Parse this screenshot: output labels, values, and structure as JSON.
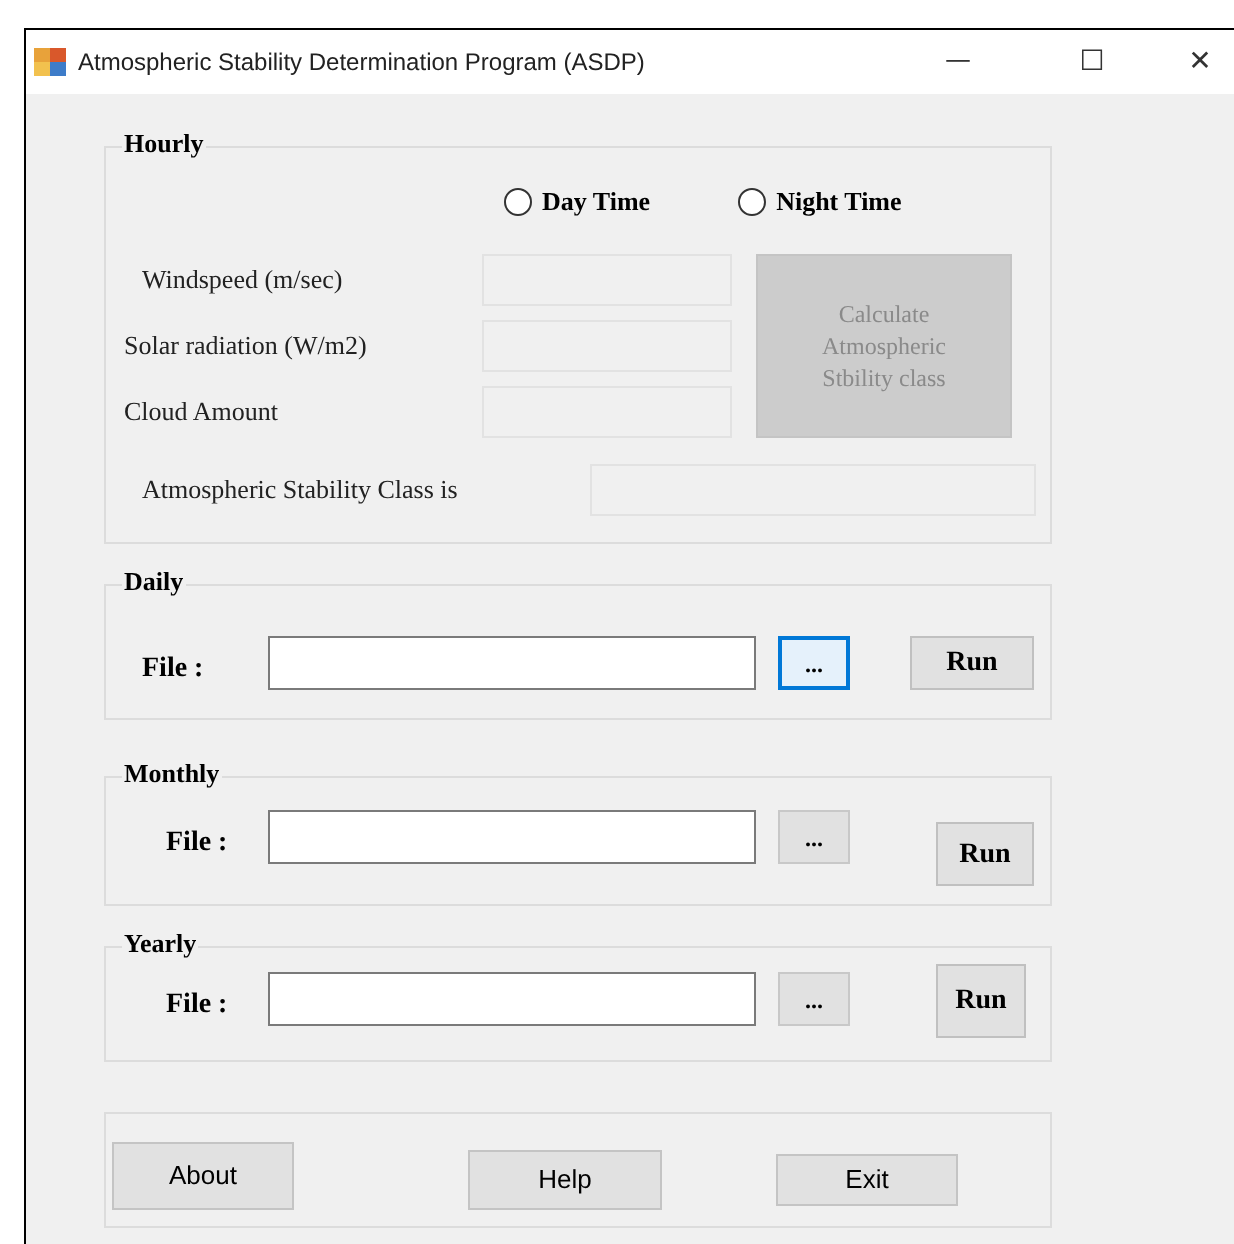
{
  "window": {
    "title": "Atmospheric Stability Determination Program (ASDP)",
    "controls": [
      "—",
      "☐",
      "✕"
    ]
  },
  "hourly": {
    "title": "Hourly",
    "radios": [
      {
        "label": "Day Time",
        "selected": false
      },
      {
        "label": "Night Time",
        "selected": false
      }
    ],
    "inputs": [
      {
        "label": "Windspeed (m/sec)"
      },
      {
        "label": "Solar radiation (W/m2)"
      },
      {
        "label": "Cloud Amount"
      }
    ],
    "calculate_button": {
      "label": "Calculate Atmospheric Stbility class",
      "disabled": true
    },
    "result": {
      "label": "Atmospheric Stability Class  is"
    }
  },
  "sections": [
    {
      "title": "Daily",
      "file_label": "File :",
      "browse": {
        "label": "...",
        "focused": true
      },
      "run": "Run"
    },
    {
      "title": "Monthly",
      "file_label": "File :",
      "browse": {
        "label": "...",
        "focused": false
      },
      "run": "Run"
    },
    {
      "title": "Yearly",
      "file_label": "File :",
      "browse": {
        "label": "...",
        "focused": false
      },
      "run": "Run"
    }
  ],
  "buttons": [
    "About",
    "Help",
    "Exit"
  ]
}
